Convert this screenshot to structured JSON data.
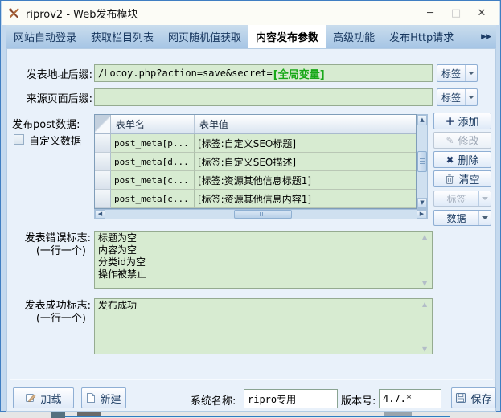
{
  "window": {
    "title": "riprov2 - Web发布模块",
    "minimize": "─",
    "maximize": "□",
    "close": "✕"
  },
  "tabs": {
    "items": [
      {
        "label": "网站自动登录"
      },
      {
        "label": "获取栏目列表"
      },
      {
        "label": "网页随机值获取"
      },
      {
        "label": "内容发布参数"
      },
      {
        "label": "高级功能"
      },
      {
        "label": "发布Http请求"
      }
    ],
    "active_index": 3,
    "overflow": "▶▶"
  },
  "form": {
    "publish_url": {
      "label": "发表地址后缀:",
      "value_prefix": "/Locoy.php?action=save&secret=",
      "value_tag": "[全局变量]",
      "tag_button": "标签"
    },
    "source_page": {
      "label": "来源页面后缀:",
      "value": "",
      "tag_button": "标签"
    },
    "post_data_label": "发布post数据:",
    "custom_data_label": "自定义数据",
    "custom_data_checked": false
  },
  "post_table": {
    "headers": {
      "name": "表单名",
      "value": "表单值"
    },
    "rows": [
      {
        "name": "post_meta[p...",
        "value": "[标签:自定义SEO标题]"
      },
      {
        "name": "post_meta[d...",
        "value": "[标签:自定义SEO描述]"
      },
      {
        "name": "post_meta[c...",
        "value": "[标签:资源其他信息标题1]"
      },
      {
        "name": "post_meta[c...",
        "value": "[标签:资源其他信息内容1]"
      }
    ],
    "actions": {
      "add": "添加",
      "edit": "修改",
      "delete": "删除",
      "clear": "清空",
      "tag_dropdown": "标签",
      "data_dropdown": "数据"
    }
  },
  "error_flags": {
    "label": "发表错误标志:",
    "sublabel": "(一行一个)",
    "value": "标题为空\n内容为空\n分类id为空\n操作被禁止"
  },
  "success_flags": {
    "label": "发表成功标志:",
    "sublabel": "(一行一个)",
    "value": "发布成功"
  },
  "footer": {
    "load": "加载",
    "create": "新建",
    "system_name_label": "系统名称:",
    "system_name_value": "ripro专用",
    "version_label": "版本号:",
    "version_value": "4.7.*",
    "save": "保存"
  },
  "icons": {
    "add": "✚",
    "edit": "✎",
    "delete": "✖",
    "scroll_up": "▲",
    "scroll_down": "▼",
    "scroll_left": "◀",
    "scroll_right": "▶",
    "textarea_up": "▲",
    "textarea_down": "▼"
  },
  "colors": {
    "accent_green_text": "#18a818",
    "input_green_bg": "#d7ebd1",
    "window_border_blue": "#3f7ec2"
  }
}
